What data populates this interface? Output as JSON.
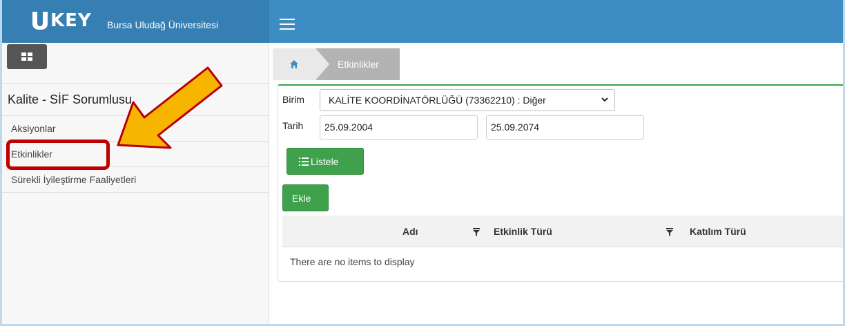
{
  "header": {
    "logo_text": "KEY",
    "university": "Bursa Uludağ Üniversitesi"
  },
  "sidebar": {
    "heading": "Kalite - SİF Sorumlusu",
    "items": [
      {
        "label": "Aksiyonlar"
      },
      {
        "label": "Etkinlikler"
      },
      {
        "label": "Sürekli İyileştirme Faaliyetleri"
      }
    ]
  },
  "breadcrumb": {
    "current": "Etkinlikler"
  },
  "form": {
    "birim_label": "Birim",
    "birim_value": "KALİTE KOORDİNATÖRLÜĞÜ (73362210) : Diğer",
    "tarih_label": "Tarih",
    "start_date": "25.09.2004",
    "end_date": "25.09.2074",
    "list_button": "Listele",
    "add_button": "Ekle"
  },
  "table": {
    "columns": [
      "Adı",
      "Etkinlik Türü",
      "Katılım Türü"
    ],
    "empty_text": "There are no items to display"
  },
  "colors": {
    "topbar": "#3d8dc4",
    "brand": "#367fb3",
    "green": "#3fa14c",
    "highlight": "#c00000",
    "arrow_fill": "#f7b500"
  }
}
